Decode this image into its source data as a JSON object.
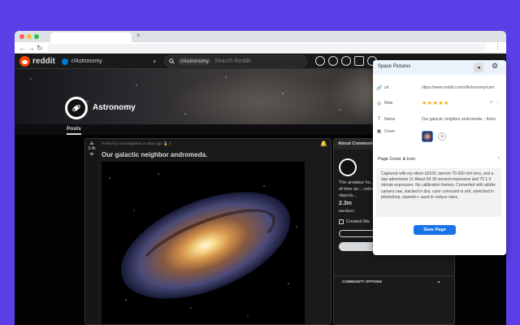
{
  "browser": {
    "colors": {
      "close": "#ff5f57",
      "minimize": "#febc2e",
      "maximize": "#28c840"
    }
  },
  "reddit": {
    "brand": "reddit",
    "community_switcher": "r/Astronomy",
    "search": {
      "chip": "r/Astronomy",
      "placeholder": "Search Reddit"
    },
    "subreddit_name": "Astronomy",
    "posts_tab": "Posts",
    "post": {
      "votes": "3.4k",
      "meta": "Posted by u/xxstargrews 10 days ago",
      "awards": "2",
      "title": "Our galactic neighbor andromeda."
    },
    "about": {
      "header": "About Community",
      "description": "The amateur ho... dawn of time an... celestial objects...",
      "members_count": "2.3m",
      "members_label": "Members",
      "created": "Created Ma",
      "create_post": "Create Post",
      "options": "COMMUNITY OPTIONS"
    }
  },
  "popup": {
    "title": "Space Pictures",
    "properties": {
      "url": {
        "label": "url",
        "value": "https://www.reddit.com/r/Astronomy/com"
      },
      "note": {
        "label": "Note",
        "stars": "★★★★★"
      },
      "name": {
        "label": "Name",
        "value": "Our galactic neighbor andromeda. : Astro"
      },
      "cover": {
        "label": "Cover"
      }
    },
    "section_title": "Page Cover & Icon",
    "notes_text": "Captured with my nikon d3100, tamron 70-300 mm lens, and a star adventurer 2i. About 60 30 second exposures and 70 1.5 minute exposures. No calibration frames. Converted with adobe camera raw, stacked in dss, color corrected in siril, stretched in photoshop, starnet++ used to reduce stars.",
    "save_label": "Save Page"
  }
}
